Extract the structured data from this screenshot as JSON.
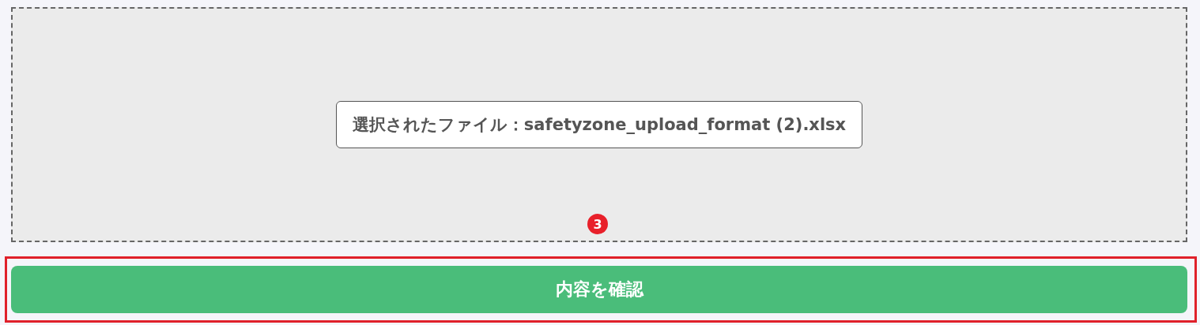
{
  "dropzone": {
    "selected_file": "選択されたファイル：safetyzone_upload_format (2).xlsx"
  },
  "step_badge": "3",
  "confirm_button": {
    "label": "内容を確認",
    "highlighted": true
  }
}
